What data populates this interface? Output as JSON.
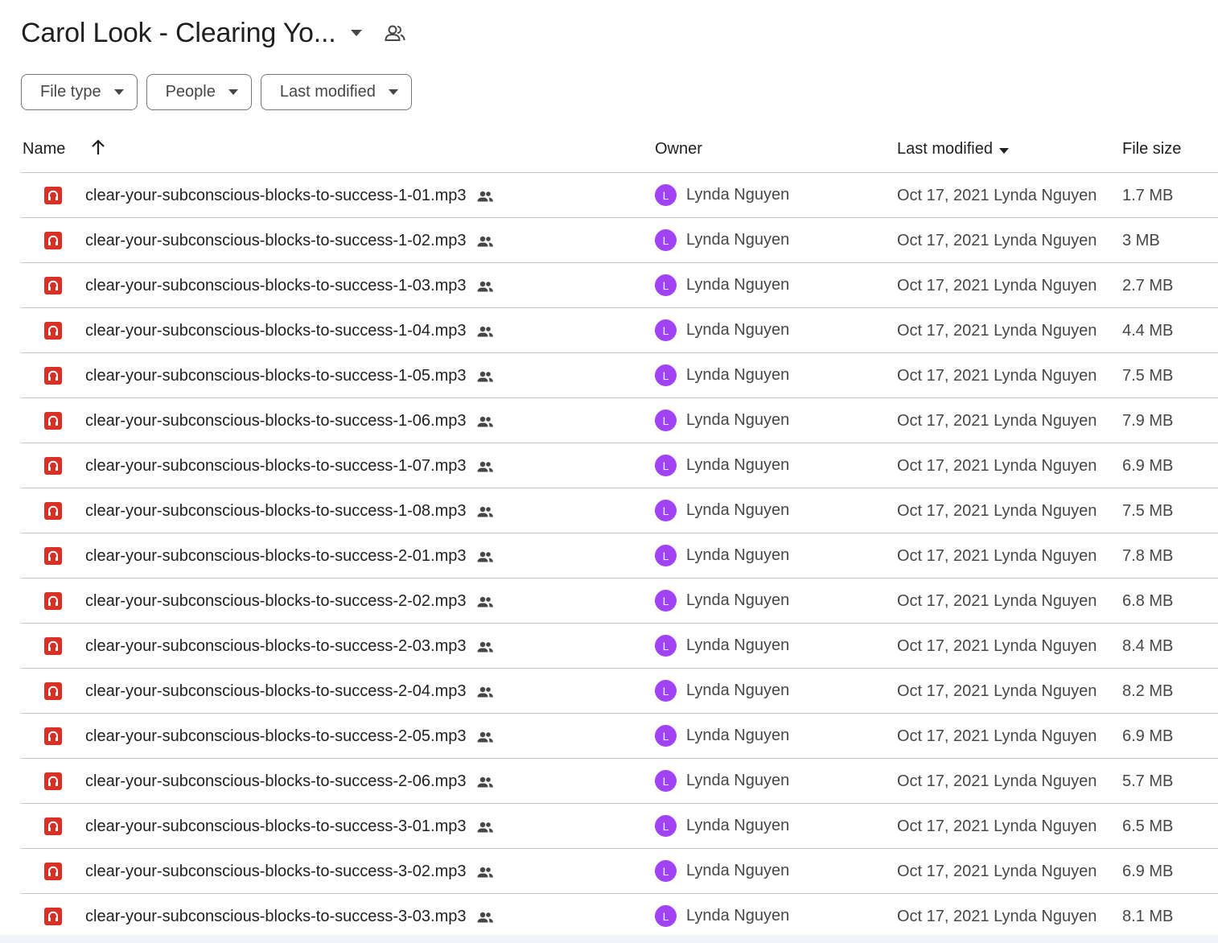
{
  "folder": {
    "title": "Carol Look - Clearing Yo...",
    "caret_icon": "arrow-drop-down-icon",
    "shared_icon": "people-icon"
  },
  "filters": [
    {
      "label": "File type"
    },
    {
      "label": "People"
    },
    {
      "label": "Last modified"
    }
  ],
  "columns": {
    "name": "Name",
    "owner": "Owner",
    "last_modified": "Last modified",
    "file_size": "File size"
  },
  "colors": {
    "audio_icon": "#d93025",
    "avatar": "#a142f4",
    "border": "#c4c7c5"
  },
  "files": [
    {
      "name": "clear-your-subconscious-blocks-to-success-1-01.mp3",
      "owner_initial": "L",
      "owner": "Lynda Nguyen",
      "modified": "Oct 17, 2021 Lynda Nguyen",
      "size": "1.7 MB"
    },
    {
      "name": "clear-your-subconscious-blocks-to-success-1-02.mp3",
      "owner_initial": "L",
      "owner": "Lynda Nguyen",
      "modified": "Oct 17, 2021 Lynda Nguyen",
      "size": "3 MB"
    },
    {
      "name": "clear-your-subconscious-blocks-to-success-1-03.mp3",
      "owner_initial": "L",
      "owner": "Lynda Nguyen",
      "modified": "Oct 17, 2021 Lynda Nguyen",
      "size": "2.7 MB"
    },
    {
      "name": "clear-your-subconscious-blocks-to-success-1-04.mp3",
      "owner_initial": "L",
      "owner": "Lynda Nguyen",
      "modified": "Oct 17, 2021 Lynda Nguyen",
      "size": "4.4 MB"
    },
    {
      "name": "clear-your-subconscious-blocks-to-success-1-05.mp3",
      "owner_initial": "L",
      "owner": "Lynda Nguyen",
      "modified": "Oct 17, 2021 Lynda Nguyen",
      "size": "7.5 MB"
    },
    {
      "name": "clear-your-subconscious-blocks-to-success-1-06.mp3",
      "owner_initial": "L",
      "owner": "Lynda Nguyen",
      "modified": "Oct 17, 2021 Lynda Nguyen",
      "size": "7.9 MB"
    },
    {
      "name": "clear-your-subconscious-blocks-to-success-1-07.mp3",
      "owner_initial": "L",
      "owner": "Lynda Nguyen",
      "modified": "Oct 17, 2021 Lynda Nguyen",
      "size": "6.9 MB"
    },
    {
      "name": "clear-your-subconscious-blocks-to-success-1-08.mp3",
      "owner_initial": "L",
      "owner": "Lynda Nguyen",
      "modified": "Oct 17, 2021 Lynda Nguyen",
      "size": "7.5 MB"
    },
    {
      "name": "clear-your-subconscious-blocks-to-success-2-01.mp3",
      "owner_initial": "L",
      "owner": "Lynda Nguyen",
      "modified": "Oct 17, 2021 Lynda Nguyen",
      "size": "7.8 MB"
    },
    {
      "name": "clear-your-subconscious-blocks-to-success-2-02.mp3",
      "owner_initial": "L",
      "owner": "Lynda Nguyen",
      "modified": "Oct 17, 2021 Lynda Nguyen",
      "size": "6.8 MB"
    },
    {
      "name": "clear-your-subconscious-blocks-to-success-2-03.mp3",
      "owner_initial": "L",
      "owner": "Lynda Nguyen",
      "modified": "Oct 17, 2021 Lynda Nguyen",
      "size": "8.4 MB"
    },
    {
      "name": "clear-your-subconscious-blocks-to-success-2-04.mp3",
      "owner_initial": "L",
      "owner": "Lynda Nguyen",
      "modified": "Oct 17, 2021 Lynda Nguyen",
      "size": "8.2 MB"
    },
    {
      "name": "clear-your-subconscious-blocks-to-success-2-05.mp3",
      "owner_initial": "L",
      "owner": "Lynda Nguyen",
      "modified": "Oct 17, 2021 Lynda Nguyen",
      "size": "6.9 MB"
    },
    {
      "name": "clear-your-subconscious-blocks-to-success-2-06.mp3",
      "owner_initial": "L",
      "owner": "Lynda Nguyen",
      "modified": "Oct 17, 2021 Lynda Nguyen",
      "size": "5.7 MB"
    },
    {
      "name": "clear-your-subconscious-blocks-to-success-3-01.mp3",
      "owner_initial": "L",
      "owner": "Lynda Nguyen",
      "modified": "Oct 17, 2021 Lynda Nguyen",
      "size": "6.5 MB"
    },
    {
      "name": "clear-your-subconscious-blocks-to-success-3-02.mp3",
      "owner_initial": "L",
      "owner": "Lynda Nguyen",
      "modified": "Oct 17, 2021 Lynda Nguyen",
      "size": "6.9 MB"
    },
    {
      "name": "clear-your-subconscious-blocks-to-success-3-03.mp3",
      "owner_initial": "L",
      "owner": "Lynda Nguyen",
      "modified": "Oct 17, 2021 Lynda Nguyen",
      "size": "8.1 MB"
    }
  ]
}
